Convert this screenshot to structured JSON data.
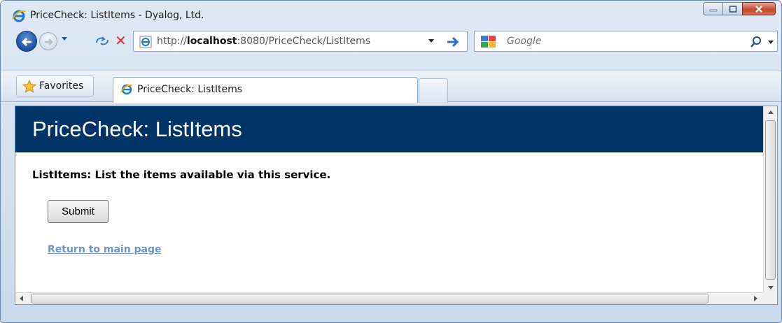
{
  "window": {
    "title": "PriceCheck: ListItems - Dyalog, Ltd."
  },
  "navigation": {
    "address_prefix": "http://",
    "address_host": "localhost",
    "address_rest": ":8080/PriceCheck/ListItems",
    "search_placeholder": "Google"
  },
  "favorites": {
    "label": "Favorites"
  },
  "tabs": [
    {
      "label": "PriceCheck: ListItems",
      "active": true
    }
  ],
  "page": {
    "banner_title": "PriceCheck: ListItems",
    "description": "ListItems: List the items available via this service.",
    "submit_label": "Submit",
    "return_link": "Return to main page",
    "colors": {
      "banner": "#003366",
      "link": "#6f93c8"
    }
  },
  "icons": {
    "title": "ie-logo-icon",
    "back": "back-arrow-icon",
    "forward": "forward-arrow-icon",
    "refresh": "refresh-icon",
    "stop": "stop-icon",
    "go": "go-arrow-icon",
    "search_provider": "google-icon",
    "search": "magnifier-icon",
    "favorites": "star-icon"
  }
}
